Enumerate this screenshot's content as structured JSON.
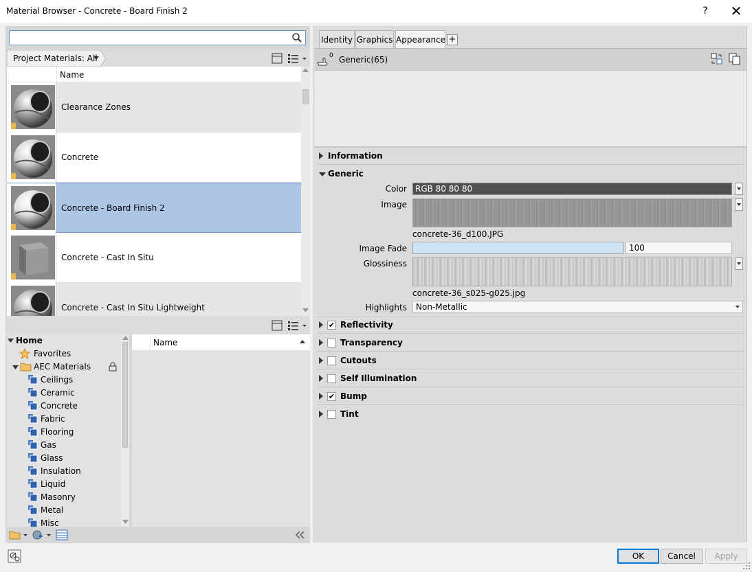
{
  "window": {
    "title": "Material Browser - Concrete - Board Finish 2",
    "help": "?",
    "close": "✕"
  },
  "search": {
    "placeholder": "",
    "value": ""
  },
  "library_crumb": "Project Materials: All",
  "material_list": {
    "column_name": "Name",
    "items": [
      {
        "name": "Clearance Zones",
        "selected": false
      },
      {
        "name": "Concrete",
        "selected": false
      },
      {
        "name": "Concrete - Board Finish 2",
        "selected": true
      },
      {
        "name": "Concrete - Cast In Situ",
        "selected": false
      },
      {
        "name": "Concrete - Cast In Situ Lightweight",
        "selected": false
      }
    ]
  },
  "tree": {
    "home": "Home",
    "favorites": "Favorites",
    "aec": "AEC Materials",
    "categories": [
      "Ceilings",
      "Ceramic",
      "Concrete",
      "Fabric",
      "Flooring",
      "Gas",
      "Glass",
      "Insulation",
      "Liquid",
      "Masonry",
      "Metal",
      "Misc"
    ]
  },
  "library_grid": {
    "column_name": "Name"
  },
  "tabs": [
    "Identity",
    "Graphics",
    "Appearance"
  ],
  "asset": {
    "count": "0",
    "name": "Generic(65)"
  },
  "sections": {
    "information": "Information",
    "generic": "Generic",
    "reflectivity": "Reflectivity",
    "transparency": "Transparency",
    "cutouts": "Cutouts",
    "self_illumination": "Self Illumination",
    "bump": "Bump",
    "tint": "Tint"
  },
  "checks": {
    "reflectivity": true,
    "transparency": false,
    "cutouts": false,
    "self_illumination": false,
    "bump": true,
    "tint": false
  },
  "generic": {
    "color_label": "Color",
    "color_value": "RGB 80 80 80",
    "image_label": "Image",
    "image_file": "concrete-36_d100.JPG",
    "fade_label": "Image Fade",
    "fade_value": "100",
    "gloss_label": "Glossiness",
    "gloss_file": "concrete-36_s025-g025.jpg",
    "highlights_label": "Highlights",
    "highlights_value": "Non-Metallic"
  },
  "buttons": {
    "ok": "OK",
    "cancel": "Cancel",
    "apply": "Apply"
  },
  "colors": {
    "selection": "#adc6e6",
    "accent": "#0078d7",
    "folder": "#e8b84a",
    "star": "#e6a23c",
    "category_icon": "#3a6fb7"
  }
}
